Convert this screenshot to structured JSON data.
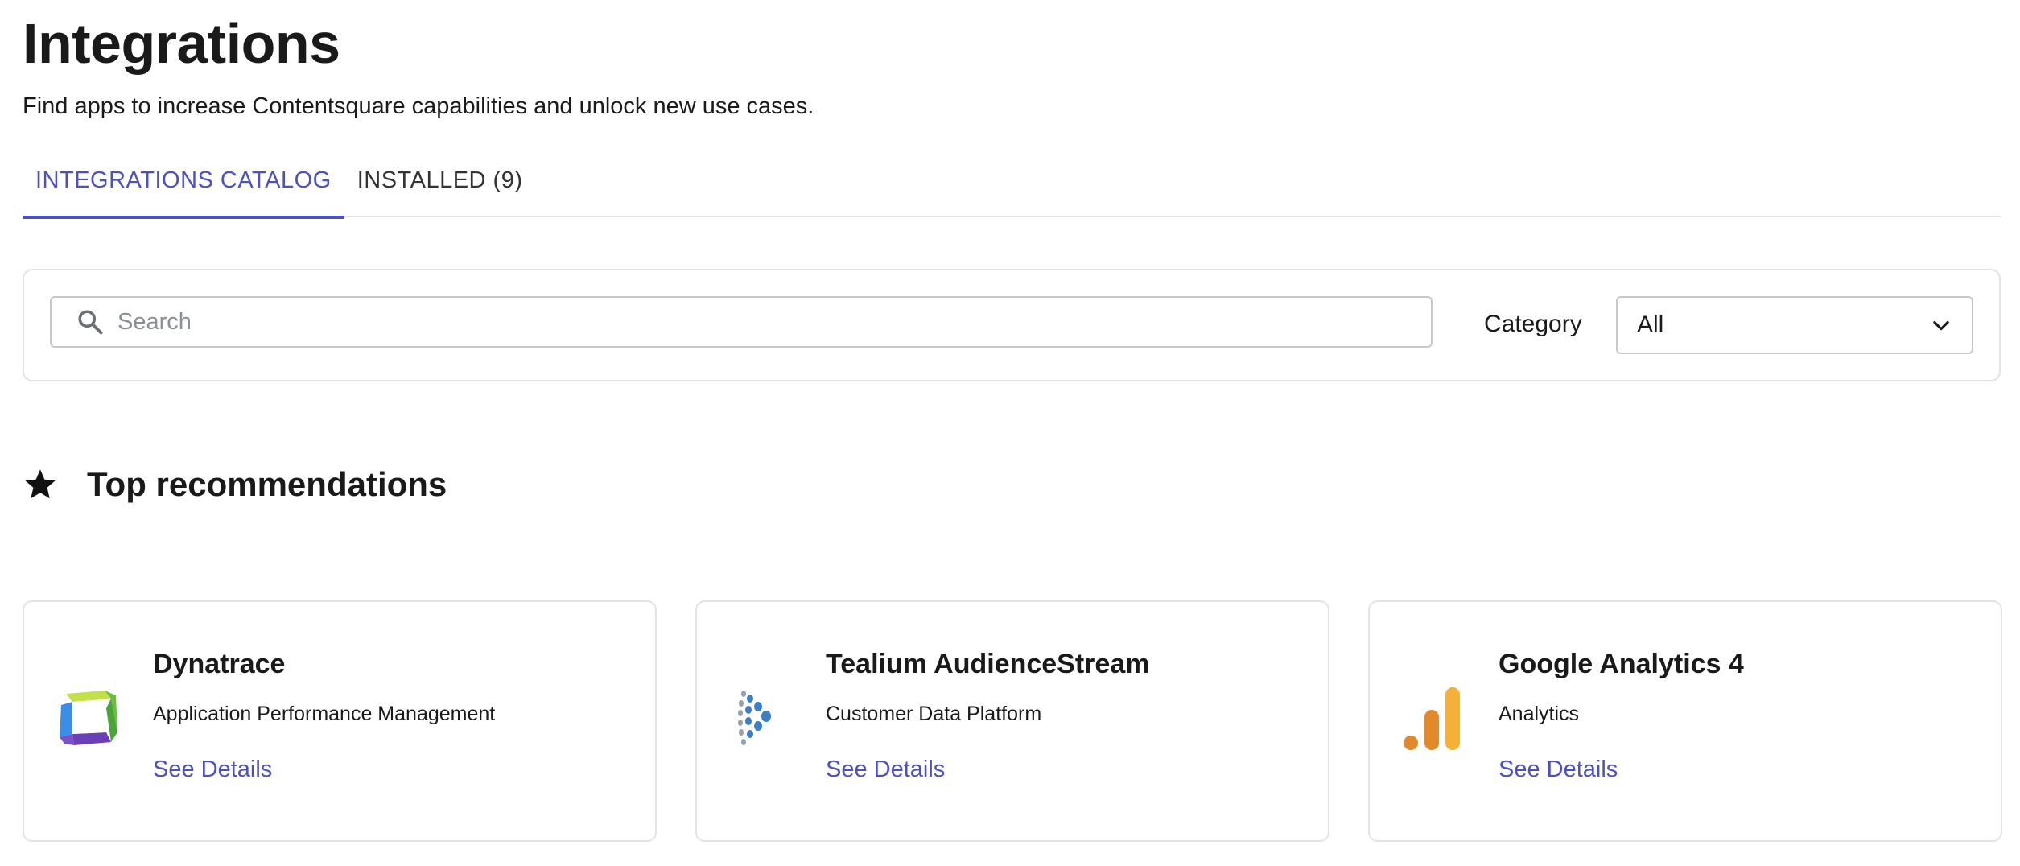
{
  "header": {
    "title": "Integrations",
    "subtitle": "Find apps to increase Contentsquare capabilities and unlock new use cases."
  },
  "tabs": [
    {
      "label": "INTEGRATIONS CATALOG",
      "active": true
    },
    {
      "label": "INSTALLED (9)",
      "active": false
    }
  ],
  "filters": {
    "search_placeholder": "Search",
    "search_value": "",
    "category_label": "Category",
    "category_value": "All"
  },
  "section": {
    "title": "Top recommendations",
    "icon": "star-icon"
  },
  "cards": [
    {
      "name": "Dynatrace",
      "category": "Application Performance Management",
      "link": "See Details",
      "logo": "dynatrace-logo"
    },
    {
      "name": "Tealium AudienceStream",
      "category": "Customer Data Platform",
      "link": "See Details",
      "logo": "tealium-logo"
    },
    {
      "name": "Google Analytics 4",
      "category": "Analytics",
      "link": "See Details",
      "logo": "google-analytics-logo"
    }
  ],
  "colors": {
    "accent": "#4c51bf",
    "text": "#1a1a1a",
    "border": "#e3e3e6"
  }
}
